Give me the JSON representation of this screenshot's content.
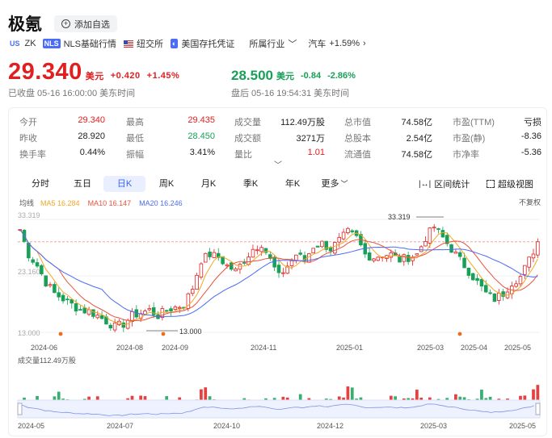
{
  "header": {
    "name": "极氪",
    "watch_label": "添加自选",
    "market_tag": "US",
    "ticker": "ZK",
    "nls_tag": "NLS",
    "nls_label": "NLS基础行情",
    "exchange": "纽交所",
    "type": "美国存托凭证",
    "industry_label": "所属行业",
    "industry": "汽车",
    "industry_change": "+1.59%"
  },
  "quote": {
    "price": "29.340",
    "currency": "美元",
    "change": "+0.420",
    "change_pct": "+1.45%",
    "close_status": "已收盘 05-16 16:00:00 美东时间",
    "after_price": "28.500",
    "after_currency": "美元",
    "after_change": "-0.84",
    "after_change_pct": "-2.86%",
    "after_status": "盘后 05-16 19:54:31 美东时间"
  },
  "stats": [
    [
      [
        "今开",
        "29.340",
        "red"
      ],
      [
        "最高",
        "29.435",
        "red"
      ],
      [
        "成交量",
        "112.49万股",
        "dark"
      ],
      [
        "总市值",
        "74.58亿",
        "dark"
      ],
      [
        "市盈(TTM)",
        "亏损",
        "dark"
      ]
    ],
    [
      [
        "昨收",
        "28.920",
        "dark"
      ],
      [
        "最低",
        "28.450",
        "green"
      ],
      [
        "成交额",
        "3271万",
        "dark"
      ],
      [
        "总股本",
        "2.54亿",
        "dark"
      ],
      [
        "市盈(静)",
        "-8.36",
        "dark"
      ]
    ],
    [
      [
        "换手率",
        "0.44%",
        "dark"
      ],
      [
        "振幅",
        "3.41%",
        "dark"
      ],
      [
        "量比",
        "1.01",
        "red"
      ],
      [
        "流通值",
        "74.58亿",
        "dark"
      ],
      [
        "市净率",
        "-5.36",
        "dark"
      ]
    ]
  ],
  "tabs": [
    "分时",
    "五日",
    "日K",
    "周K",
    "月K",
    "季K",
    "年K",
    "更多"
  ],
  "active_tab": "日K",
  "tools": {
    "range_stats": "区间统计",
    "super_view": "超级视图"
  },
  "legend": {
    "ma_label": "均线",
    "ma5": "MA5 16.284",
    "ma10": "MA10 16.147",
    "ma20": "MA20 16.246",
    "adjust": "不复权"
  },
  "colors": {
    "up": "#e02020",
    "down": "#18a058",
    "ma5": "#f5a623",
    "ma10": "#e8533a",
    "ma20": "#4a6cf7"
  },
  "chart_data": {
    "type": "candlestick",
    "y_ticks": [
      "33.319",
      "23.160",
      "13.000"
    ],
    "ylim": [
      13.0,
      33.319
    ],
    "x_ticks": [
      "2024-06",
      "2024-08",
      "2024-09",
      "2024-11",
      "2025-01",
      "2025-03",
      "2025-04",
      "2025-05"
    ],
    "max_label": "33.319",
    "min_label": "13.000",
    "volume_label": "成交量112.49万股",
    "nav_ticks": [
      "2024-05",
      "2024-07",
      "2024-10",
      "2024-12",
      "2025-03",
      "2025-05"
    ],
    "close_path": [
      [
        0,
        31.5
      ],
      [
        2,
        27
      ],
      [
        4,
        25
      ],
      [
        6,
        22
      ],
      [
        8,
        20
      ],
      [
        10,
        19
      ],
      [
        12,
        18
      ],
      [
        14,
        17
      ],
      [
        16,
        16.8
      ],
      [
        18,
        16
      ],
      [
        20,
        15
      ],
      [
        22,
        14
      ],
      [
        24,
        14.5
      ],
      [
        26,
        16
      ],
      [
        28,
        16.5
      ],
      [
        30,
        17
      ],
      [
        32,
        16
      ],
      [
        34,
        17
      ],
      [
        36,
        17.5
      ],
      [
        38,
        18
      ],
      [
        40,
        21
      ],
      [
        42,
        26
      ],
      [
        44,
        27
      ],
      [
        46,
        26.5
      ],
      [
        48,
        25
      ],
      [
        50,
        24
      ],
      [
        52,
        26
      ],
      [
        54,
        28
      ],
      [
        56,
        29
      ],
      [
        58,
        26
      ],
      [
        60,
        23
      ],
      [
        62,
        25
      ],
      [
        64,
        27
      ],
      [
        66,
        26
      ],
      [
        68,
        28.5
      ],
      [
        70,
        29
      ],
      [
        72,
        28
      ],
      [
        74,
        29.5
      ],
      [
        76,
        31
      ],
      [
        78,
        30
      ],
      [
        80,
        27
      ],
      [
        82,
        26.5
      ],
      [
        84,
        27
      ],
      [
        86,
        27
      ],
      [
        88,
        26
      ],
      [
        90,
        26.5
      ],
      [
        92,
        27
      ],
      [
        94,
        30
      ],
      [
        96,
        32
      ],
      [
        98,
        30
      ],
      [
        100,
        28
      ],
      [
        102,
        26
      ],
      [
        104,
        24
      ],
      [
        106,
        22
      ],
      [
        108,
        20
      ],
      [
        110,
        19
      ],
      [
        112,
        20
      ],
      [
        114,
        22
      ],
      [
        116,
        23
      ],
      [
        118,
        26
      ],
      [
        120,
        29.3
      ]
    ]
  }
}
